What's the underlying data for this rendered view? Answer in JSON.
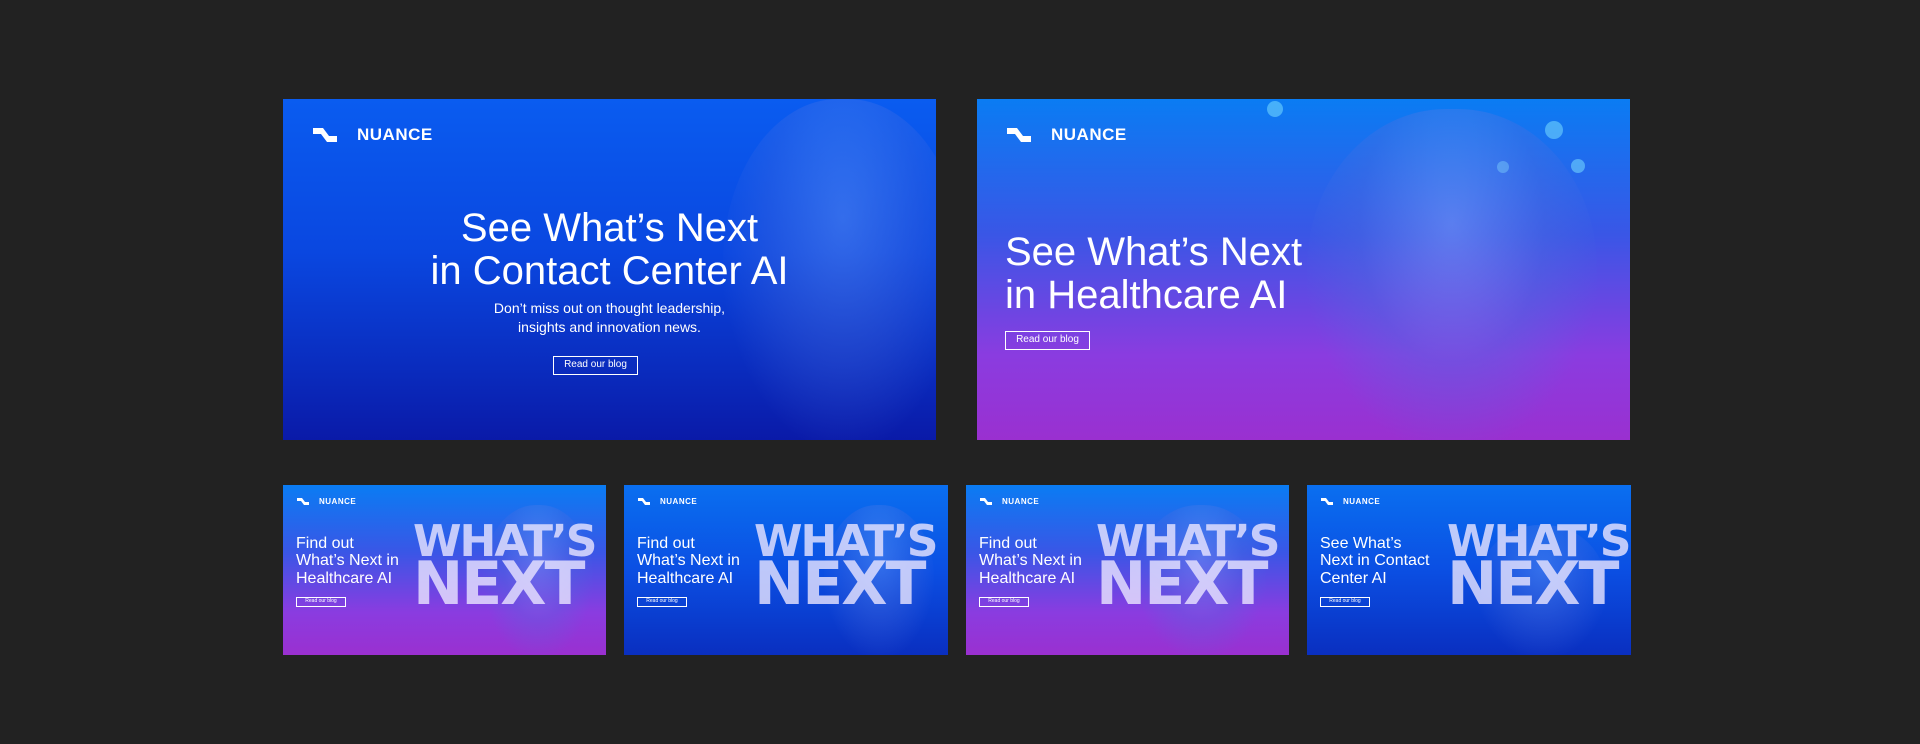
{
  "brand": {
    "name": "NUANCE"
  },
  "banners": {
    "contact_large": {
      "headline_line1": "See What’s Next",
      "headline_line2": "in Contact Center AI",
      "sub_line1": "Don’t miss out on thought leadership,",
      "sub_line2": "insights and innovation news.",
      "button": "Read our blog"
    },
    "healthcare_large": {
      "headline_line1": "See What’s Next",
      "headline_line2": "in Healthcare AI",
      "button": "Read our blog"
    },
    "small": [
      {
        "line1": "Find out",
        "line2": "What’s Next in",
        "line3": "Healthcare AI",
        "button": "Read our blog",
        "word1": "WHAT’S",
        "word2": "NEXT"
      },
      {
        "line1": "Find out",
        "line2": "What’s Next in",
        "line3": "Healthcare AI",
        "button": "Read our blog",
        "word1": "WHAT’S",
        "word2": "NEXT"
      },
      {
        "line1": "Find out",
        "line2": "What’s Next in",
        "line3": "Healthcare AI",
        "button": "Read our blog",
        "word1": "WHAT’S",
        "word2": "NEXT"
      },
      {
        "line1": "See What’s",
        "line2": "Next in Contact",
        "line3": "Center AI",
        "button": "Read our blog",
        "word1": "WHAT’S",
        "word2": "NEXT"
      }
    ]
  },
  "colors": {
    "page_bg": "#222222",
    "brand_blue": "#0a5cf0",
    "brand_purple": "#9a30d0"
  },
  "icons": {
    "logo": "nuance-logo-mark-icon"
  }
}
